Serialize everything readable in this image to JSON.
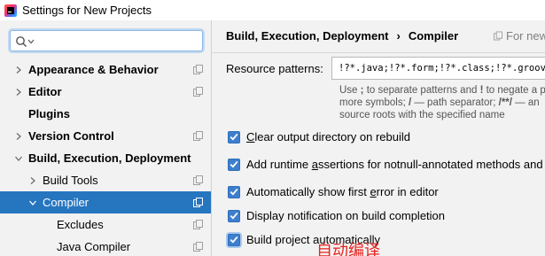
{
  "window": {
    "title": "Settings for New Projects"
  },
  "search": {
    "placeholder": ""
  },
  "sidebar": {
    "items": [
      {
        "label": "Appearance & Behavior",
        "bold": true,
        "arrow": "right"
      },
      {
        "label": "Editor",
        "bold": true,
        "arrow": "right"
      },
      {
        "label": "Plugins",
        "bold": true,
        "arrow": "none"
      },
      {
        "label": "Version Control",
        "bold": true,
        "arrow": "right"
      },
      {
        "label": "Build, Execution, Deployment",
        "bold": true,
        "arrow": "down"
      },
      {
        "label": "Build Tools",
        "bold": false,
        "arrow": "right"
      },
      {
        "label": "Compiler",
        "bold": false,
        "arrow": "down",
        "selected": true
      },
      {
        "label": "Excludes",
        "bold": false,
        "arrow": "none"
      },
      {
        "label": "Java Compiler",
        "bold": false,
        "arrow": "none"
      }
    ]
  },
  "main": {
    "breadcrumb": {
      "parent": "Build, Execution, Deployment",
      "separator": "›",
      "current": "Compiler"
    },
    "for_new_projects": "For new",
    "resource_patterns": {
      "label": "Resource patterns:",
      "value": "!?*.java;!?*.form;!?*.class;!?*.groovy;!?*.scala"
    },
    "help": {
      "line1_a": "Use ",
      "line1_b": ";",
      "line1_c": " to separate patterns and ",
      "line1_d": "!",
      "line1_e": " to negate a p",
      "line2_a": "more symbols; ",
      "line2_b": "/",
      "line2_c": " — path separator; ",
      "line2_d": "/**/",
      "line2_e": " — an",
      "line3": "source roots with the specified name"
    },
    "options": [
      {
        "pre": "",
        "mn": "C",
        "post": "lear output directory on rebuild",
        "checked": true
      },
      {
        "pre": "Add runtime ",
        "mn": "a",
        "post": "ssertions for notnull-annotated methods and",
        "checked": true
      },
      {
        "pre": "Automatically show first ",
        "mn": "e",
        "post": "rror in editor",
        "checked": true
      },
      {
        "pre": "Display notification on build completion",
        "mn": "",
        "post": "",
        "checked": true
      },
      {
        "pre": "Build project automatically",
        "mn": "",
        "post": "",
        "checked": true,
        "focused": true
      }
    ]
  },
  "annotation": {
    "text": "自动编译",
    "color": "#e8231f"
  },
  "colors": {
    "selection": "#2675bf",
    "checkbox": "#3d7fce"
  }
}
